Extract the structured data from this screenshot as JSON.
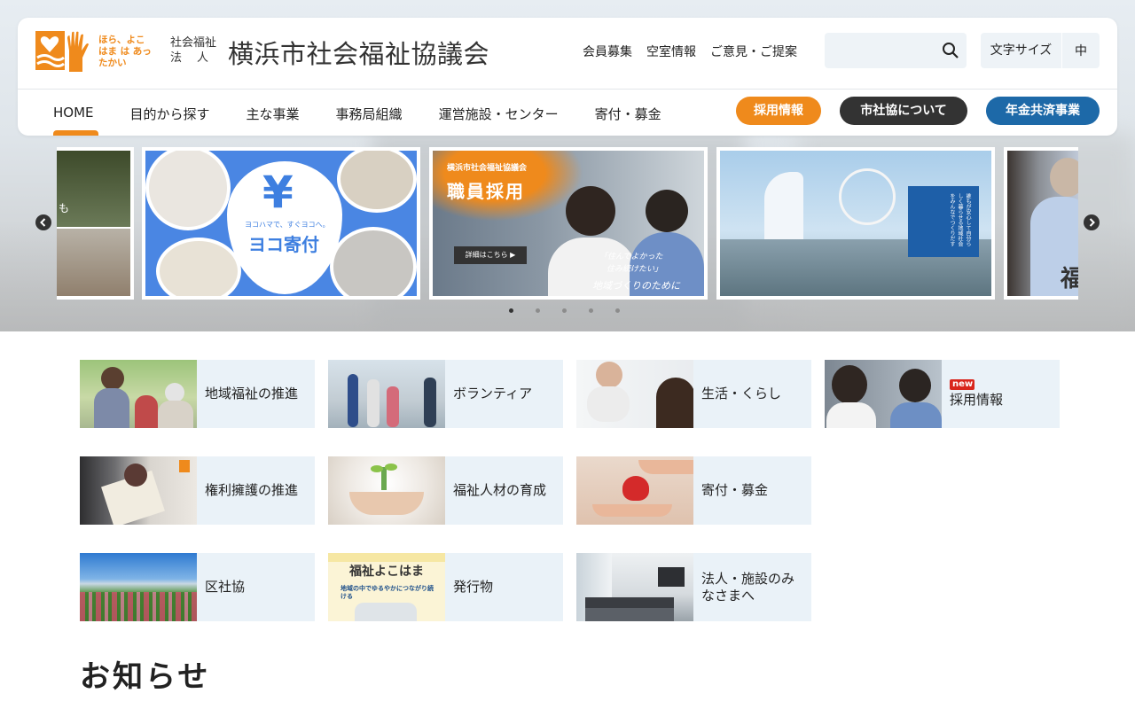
{
  "header": {
    "logo_slogan": "ほら、よこはま は あったかい",
    "org_type_line1": "社会福祉",
    "org_type_line2": "法人",
    "org_name": "横浜市社会福祉協議会",
    "util_links": [
      "会員募集",
      "空室情報",
      "ご意見・ご提案"
    ],
    "search_placeholder": "",
    "font_size_label": "文字サイズ",
    "font_size_value": "中"
  },
  "nav": {
    "items": [
      "HOME",
      "目的から探す",
      "主な事業",
      "事務局組織",
      "運営施設・センター",
      "寄付・募金"
    ],
    "active": "HOME",
    "buttons": [
      {
        "label": "採用情報",
        "color": "#ef8a1c"
      },
      {
        "label": "市社協について",
        "color": "#333333"
      },
      {
        "label": "年金共済事業",
        "color": "#1d69a8"
      }
    ]
  },
  "carousel": {
    "slides": [
      {
        "text": "も"
      },
      {
        "caption": "ヨコハマで、すぐヨコへ。",
        "title": "ヨコ寄付",
        "symbol": "¥"
      },
      {
        "org": "横浜市社会福祉協議会",
        "title": "職員採用",
        "button": "詳細はこちら ▶",
        "quote1": "「住んでよかった",
        "quote2": "住み続けたい」",
        "quote3": "地域づくりのために"
      },
      {
        "vertical_text": "誰もが安心して自分らしく暮らせる地域社会をみんなでつくりだす"
      },
      {
        "text": "福"
      }
    ],
    "dots_count": 5,
    "active_dot": 0
  },
  "categories": [
    {
      "label": "地域福祉の推進",
      "new": false
    },
    {
      "label": "ボランティア",
      "new": false
    },
    {
      "label": "生活・くらし",
      "new": false
    },
    {
      "label": "採用情報",
      "new": true,
      "badge": "new"
    },
    {
      "label": "権利擁護の推進",
      "new": false
    },
    {
      "label": "福祉人材の育成",
      "new": false
    },
    {
      "label": "寄付・募金",
      "new": false
    },
    {
      "label": "区社協",
      "new": false
    },
    {
      "label": "発行物",
      "new": false,
      "thumb_title": "福祉よこはま",
      "thumb_sub": "地域の中でゆるやかにつながり続ける"
    },
    {
      "label": "法人・施設のみなさまへ",
      "new": false
    }
  ],
  "news": {
    "title": "お知らせ"
  },
  "colors": {
    "accent": "#ef8a1c",
    "brand_blue": "#1d69a8",
    "dark": "#333333",
    "card_bg": "#eaf2f8"
  }
}
